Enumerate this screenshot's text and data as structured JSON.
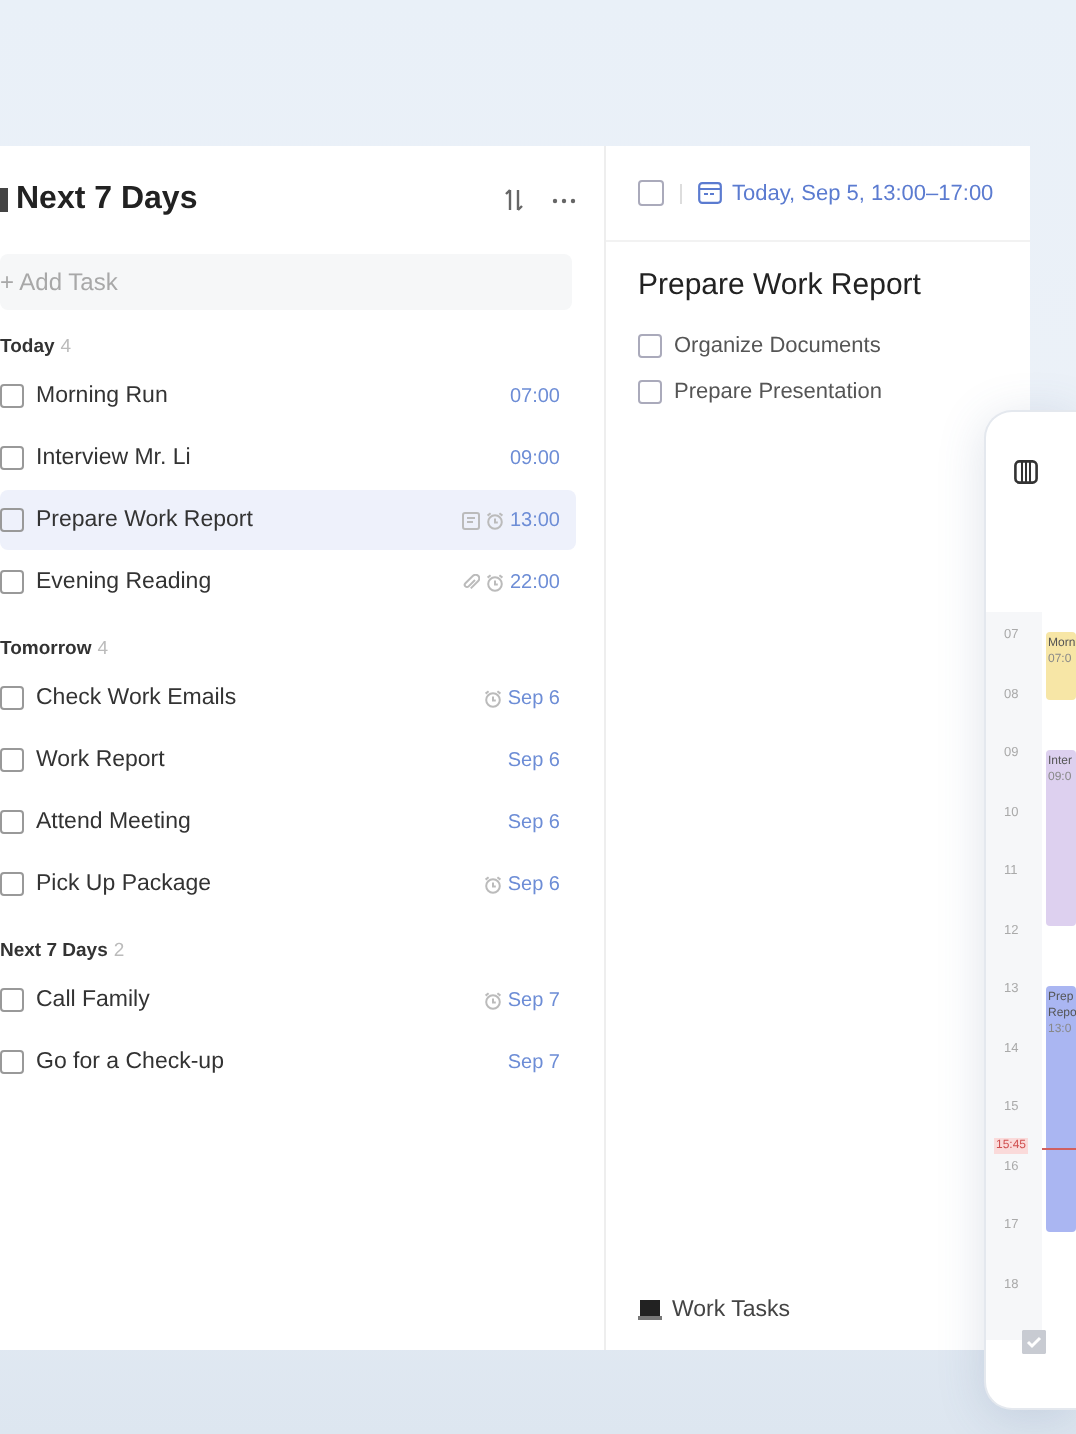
{
  "task_list": {
    "title": "Next 7 Days",
    "add_task": {
      "placeholder": "+ Add Task"
    },
    "sections": [
      {
        "name": "Today",
        "count": "4",
        "tasks": [
          {
            "title": "Morning Run",
            "checked": false,
            "selected": false,
            "due": "07:00",
            "note": false,
            "attachment": false,
            "alarm": false
          },
          {
            "title": "Interview Mr. Li",
            "checked": false,
            "selected": false,
            "due": "09:00",
            "note": false,
            "attachment": false,
            "alarm": false
          },
          {
            "title": "Prepare Work Report",
            "checked": false,
            "selected": true,
            "due": "13:00",
            "note": true,
            "attachment": false,
            "alarm": true
          },
          {
            "title": "Evening Reading",
            "checked": false,
            "selected": false,
            "due": "22:00",
            "note": false,
            "attachment": true,
            "alarm": true
          }
        ]
      },
      {
        "name": "Tomorrow",
        "count": "4",
        "tasks": [
          {
            "title": "Check Work Emails",
            "checked": false,
            "selected": false,
            "due": "Sep 6",
            "note": false,
            "attachment": false,
            "alarm": true
          },
          {
            "title": "Work Report",
            "checked": false,
            "selected": false,
            "due": "Sep 6",
            "note": false,
            "attachment": false,
            "alarm": false
          },
          {
            "title": "Attend Meeting",
            "checked": false,
            "selected": false,
            "due": "Sep 6",
            "note": false,
            "attachment": false,
            "alarm": false
          },
          {
            "title": "Pick Up Package",
            "checked": false,
            "selected": false,
            "due": "Sep 6",
            "note": false,
            "attachment": false,
            "alarm": true
          }
        ]
      },
      {
        "name": "Next 7 Days",
        "count": "2",
        "tasks": [
          {
            "title": "Call Family",
            "checked": false,
            "selected": false,
            "due": "Sep 7",
            "note": false,
            "attachment": false,
            "alarm": true
          },
          {
            "title": "Go for a Check-up",
            "checked": false,
            "selected": false,
            "due": "Sep 7",
            "note": false,
            "attachment": false,
            "alarm": false
          }
        ]
      }
    ]
  },
  "detail": {
    "checked": false,
    "date": "Today, Sep 5, 13:00–17:00",
    "title": "Prepare Work Report",
    "subtasks": [
      {
        "title": "Organize Documents",
        "checked": false
      },
      {
        "title": "Prepare Presentation",
        "checked": false
      }
    ],
    "list_name": "Work Tasks"
  },
  "calendar": {
    "hours": [
      "07",
      "08",
      "09",
      "10",
      "11",
      "12",
      "13",
      "14",
      "15",
      "16",
      "17",
      "18"
    ],
    "now": "15:45",
    "events": [
      {
        "title": "Morn",
        "time": "07:0",
        "color": "#f7e6a6"
      },
      {
        "title": "Inter",
        "time": "09:0",
        "color": "#ddd0ef"
      },
      {
        "title": "Prep Repo",
        "time": "13:0",
        "color": "#aab6f2"
      }
    ],
    "done_checked": true
  }
}
